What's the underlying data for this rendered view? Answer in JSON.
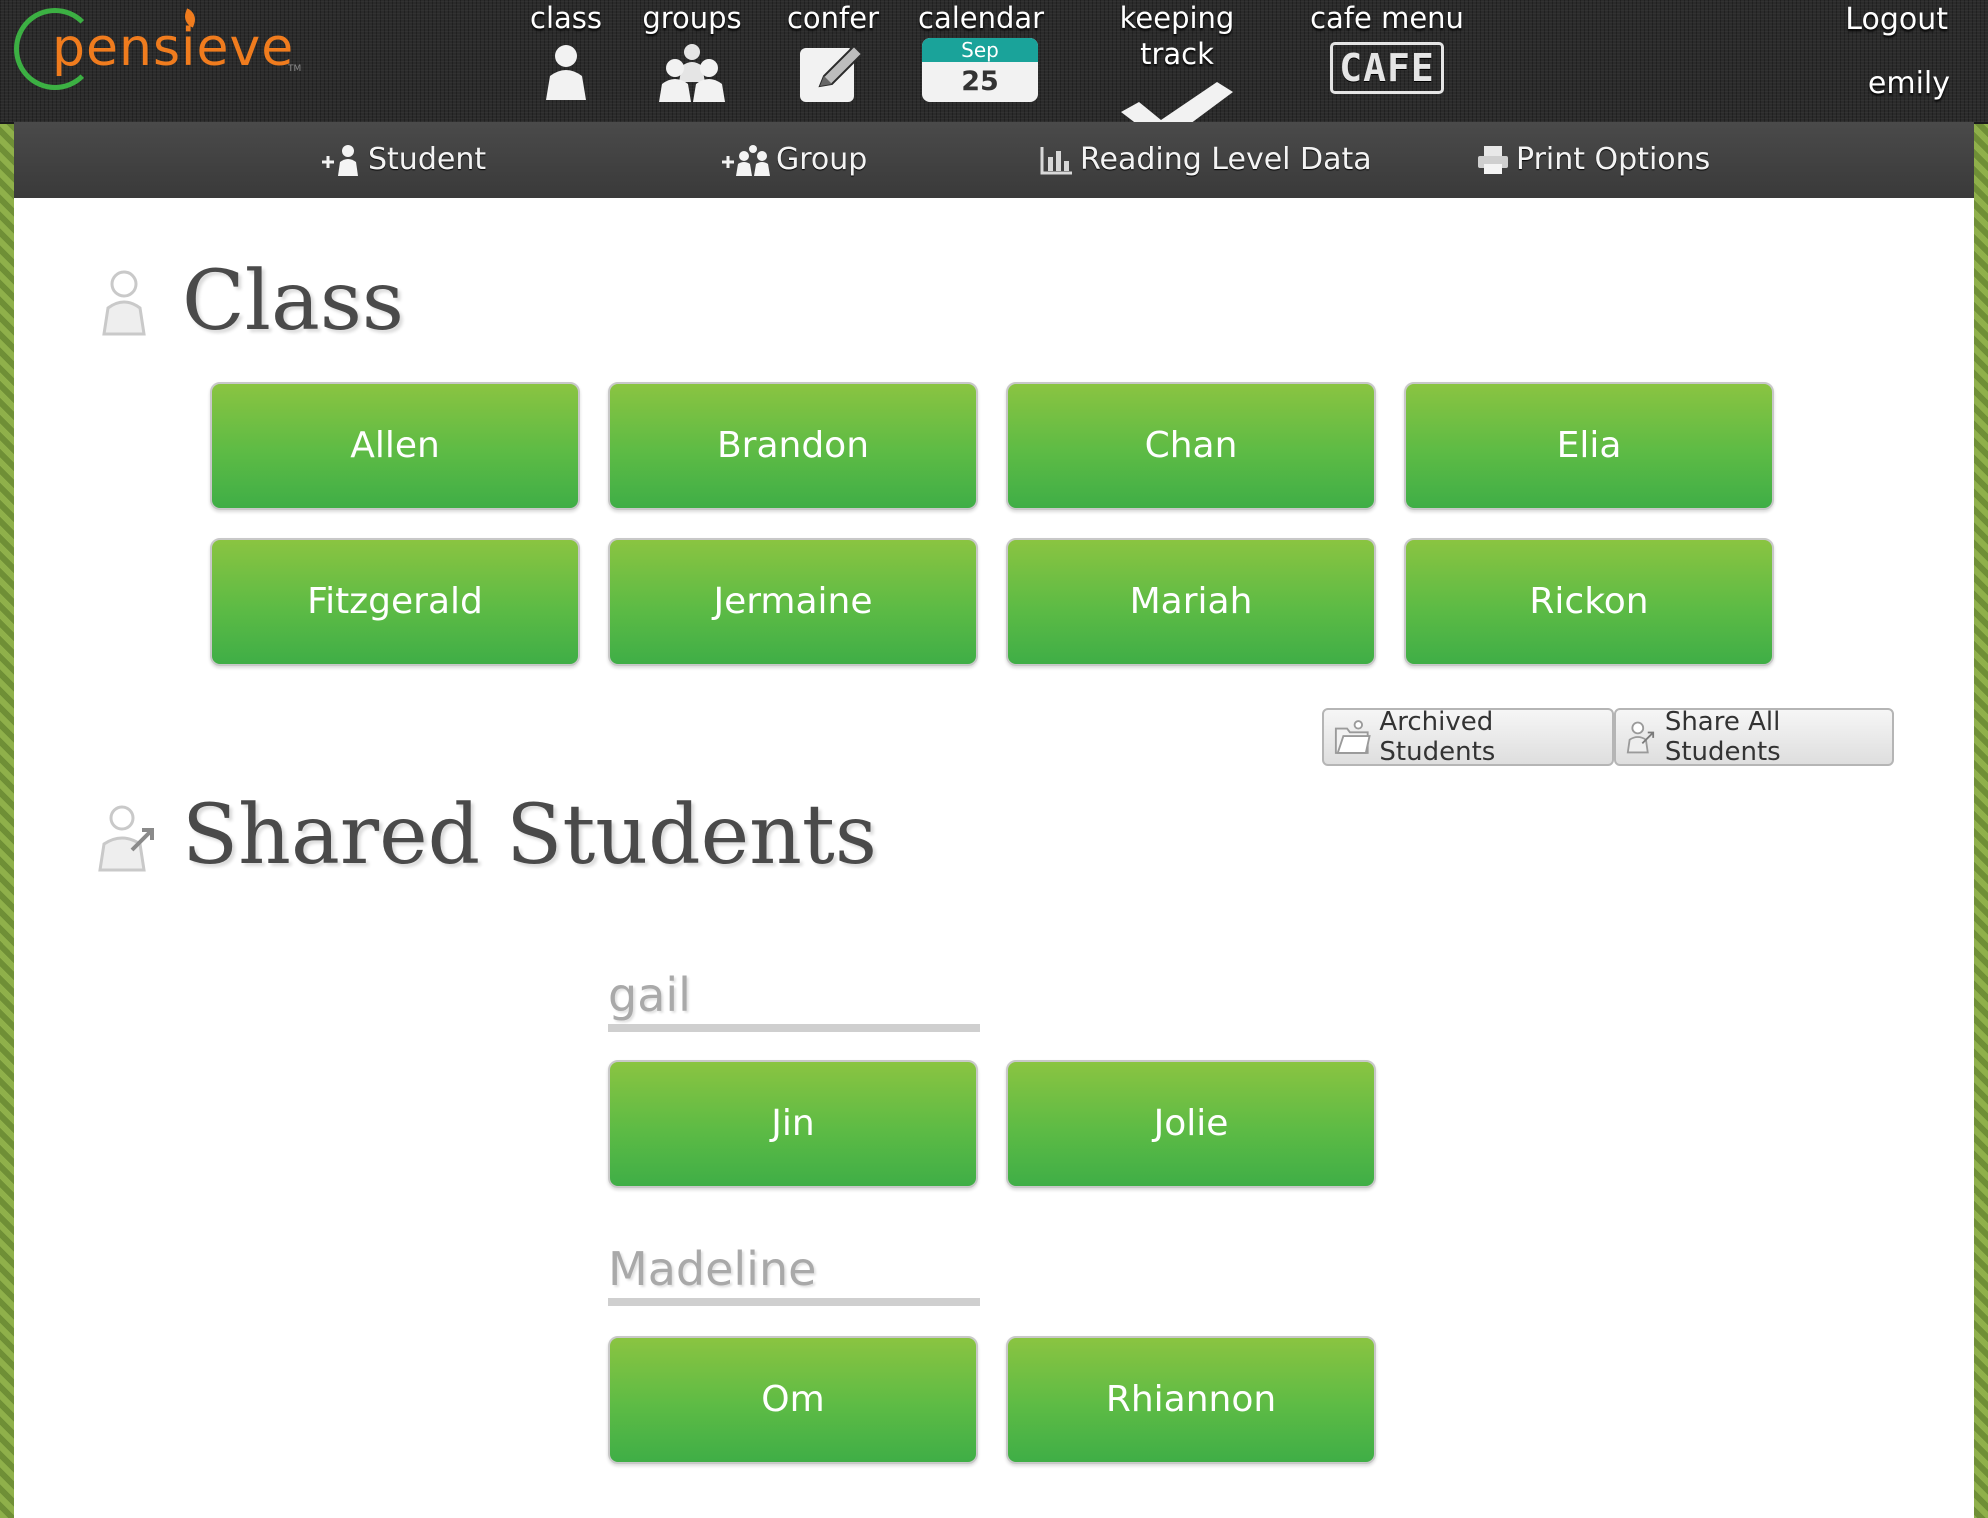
{
  "app": {
    "logo_text": "pensieve",
    "accent_green": "#5dbb45",
    "accent_orange": "#f07c1e"
  },
  "topnav": {
    "items": [
      {
        "label": "class",
        "icon": "person-icon"
      },
      {
        "label": "groups",
        "icon": "group-icon"
      },
      {
        "label": "confer",
        "icon": "pencil-note-icon"
      },
      {
        "label": "calendar",
        "icon": "calendar-icon"
      },
      {
        "label": "keeping track",
        "icon": "checkmark-icon"
      },
      {
        "label": "cafe menu",
        "icon": "cafe-icon"
      }
    ],
    "calendar": {
      "month": "Sep",
      "day": "25"
    },
    "cafe_text": "CAFE",
    "logout": "Logout",
    "username": "emily"
  },
  "subnav": {
    "add_student": "Student",
    "add_group": "Group",
    "reading_level": "Reading Level Data",
    "print_options": "Print Options"
  },
  "class_section": {
    "title": "Class",
    "students": [
      "Allen",
      "Brandon",
      "Chan",
      "Elia",
      "Fitzgerald",
      "Jermaine",
      "Mariah",
      "Rickon"
    ],
    "archived_label": "Archived Students",
    "share_all_label": "Share All Students"
  },
  "shared_section": {
    "title": "Shared Students",
    "owners": [
      {
        "name": "gail",
        "students": [
          "Jin",
          "Jolie"
        ]
      },
      {
        "name": "Madeline",
        "students": [
          "Om",
          "Rhiannon"
        ]
      }
    ]
  }
}
